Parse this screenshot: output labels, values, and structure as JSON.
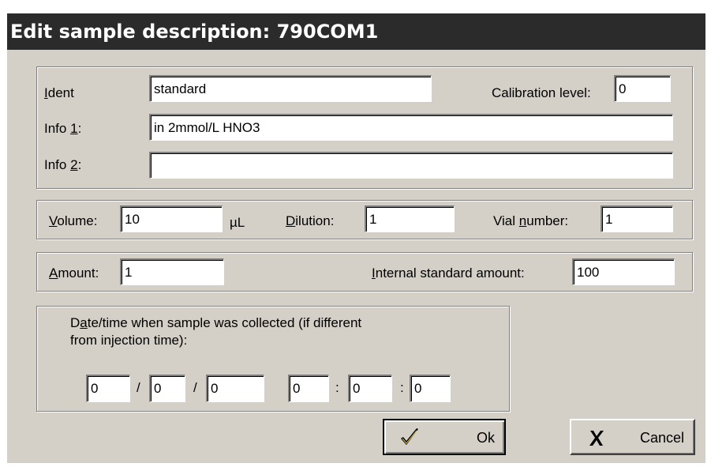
{
  "window": {
    "title": "Edit sample description: 790COM1"
  },
  "ident_group": {
    "ident_label": "Ident",
    "ident_value": "standard",
    "calibration_label": "Calibration level:",
    "calibration_value": "0",
    "info1_label": "Info 1:",
    "info1_value": "in 2mmol/L HNO3",
    "info2_label": "Info 2:",
    "info2_value": ""
  },
  "volume_group": {
    "volume_label": "Volume:",
    "volume_value": "10",
    "volume_unit": "µL",
    "dilution_label": "Dilution:",
    "dilution_value": "1",
    "vial_label": "Vial number:",
    "vial_value": "1"
  },
  "amount_group": {
    "amount_label": "Amount:",
    "amount_value": "1",
    "internal_label": "Internal standard amount:",
    "internal_value": "100"
  },
  "date_group": {
    "label_line1": "Date/time when sample was collected (if different",
    "label_line2": "from injection time):",
    "date_sep": "/",
    "time_sep": ":",
    "day": "0",
    "month": "0",
    "year": "0",
    "hour": "0",
    "minute": "0",
    "second": "0"
  },
  "buttons": {
    "ok_label": "Ok",
    "cancel_label": "Cancel"
  }
}
